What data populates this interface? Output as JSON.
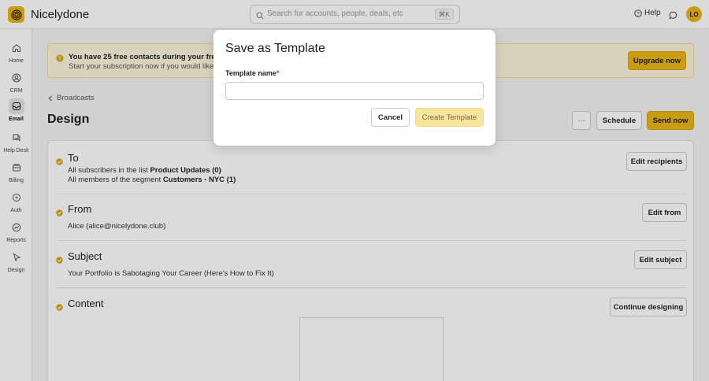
{
  "app": {
    "name": "Nicelydone"
  },
  "search": {
    "placeholder": "Search for accounts, people, deals, etc",
    "shortcut": "⌘K"
  },
  "header": {
    "help_label": "Help",
    "avatar_initials": "LO"
  },
  "sidebar": {
    "items": [
      {
        "label": "Home",
        "icon": "home-icon"
      },
      {
        "label": "CRM",
        "icon": "crm-icon"
      },
      {
        "label": "Email",
        "icon": "email-icon",
        "active": true
      },
      {
        "label": "Help Desk",
        "icon": "help-desk-icon"
      },
      {
        "label": "Billing",
        "icon": "billing-icon"
      },
      {
        "label": "Auth",
        "icon": "auth-icon"
      },
      {
        "label": "Reports",
        "icon": "reports-icon"
      },
      {
        "label": "Design",
        "icon": "design-icon"
      }
    ]
  },
  "banner": {
    "title": "You have 25 free contacts during your free trial",
    "subtitle": "Start your subscription now if you would like to i",
    "upgrade_label": "Upgrade now"
  },
  "breadcrumb": {
    "label": "Broadcasts"
  },
  "page": {
    "title": "Design",
    "more_label": "···",
    "schedule_label": "Schedule",
    "send_label": "Send now"
  },
  "sections": {
    "to": {
      "title": "To",
      "line1_prefix": "All subscribers in the list ",
      "line1_bold": "Product Updates (0)",
      "line2_prefix": "All members of the segment ",
      "line2_bold": "Customers - NYC (1)",
      "button": "Edit recipients"
    },
    "from": {
      "title": "From",
      "value": "Alice (alice@nicelydone.club)",
      "button": "Edit from"
    },
    "subject": {
      "title": "Subject",
      "value": "Your Portfolio is Sabotaging Your Career (Here's How to Fix It)",
      "button": "Edit subject"
    },
    "content": {
      "title": "Content",
      "button": "Continue designing"
    }
  },
  "modal": {
    "title": "Save as Template",
    "label": "Template name",
    "required_mark": "*",
    "input_value": "",
    "cancel_label": "Cancel",
    "create_label": "Create Template"
  },
  "colors": {
    "accent": "#e9b717",
    "success": "#d8a71a",
    "banner_bg": "#fdf6dd"
  }
}
